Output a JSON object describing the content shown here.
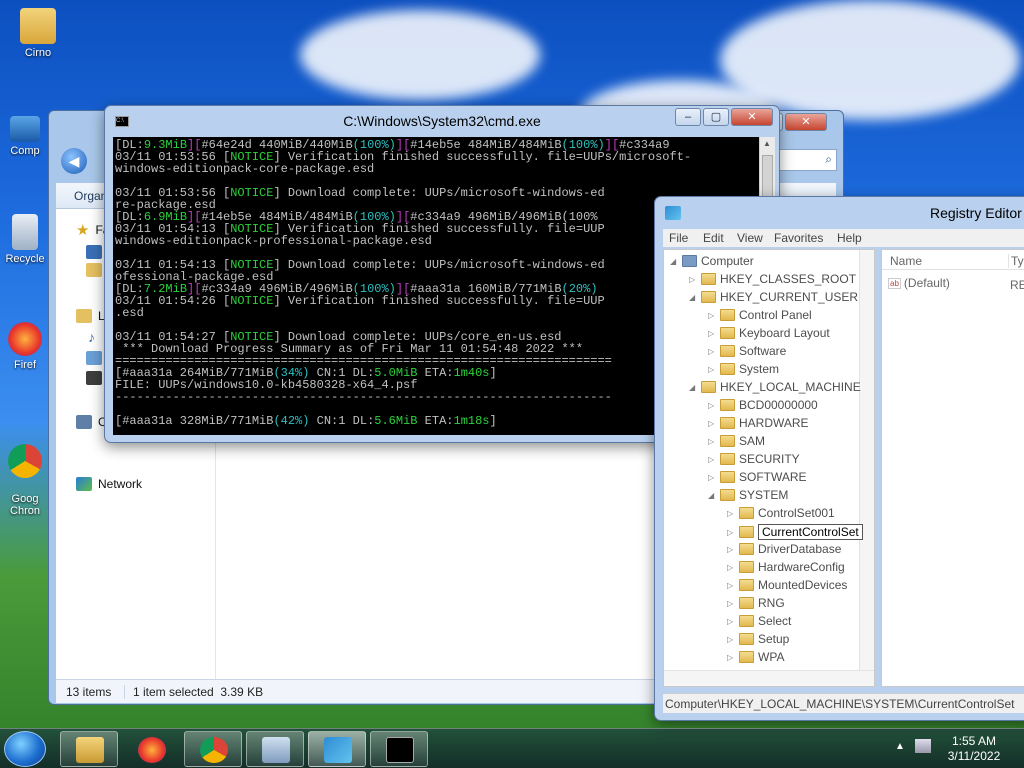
{
  "desktop": {
    "icons": [
      {
        "label": "Cirno"
      },
      {
        "label": "Comp"
      },
      {
        "label": "Recycle"
      },
      {
        "label": "Firef"
      },
      {
        "label": "Goog\nChron"
      }
    ]
  },
  "explorer": {
    "organize_label": "Organ",
    "nav_items": [
      "Fa",
      "Li",
      "Co",
      "Network"
    ],
    "status_items": "13 items",
    "status_selected": "1 item selected  3.39 KB"
  },
  "cmd": {
    "title": "C:\\Windows\\System32\\cmd.exe",
    "lines": [
      "[DL:9.3MiB][#64e24d 440MiB/440MiB(100%)][#14eb5e 484MiB/484MiB(100%)][#c334a9",
      "03/11 01:53:56 [NOTICE] Verification finished successfully. file=UUPs/microsoft-",
      "windows-editionpack-core-package.esd",
      "",
      "03/11 01:53:56 [NOTICE] Download complete: UUPs/microsoft-windows-ed",
      "re-package.esd",
      "[DL:6.9MiB][#14eb5e 484MiB/484MiB(100%)][#c334a9 496MiB/496MiB(100%",
      "03/11 01:54:13 [NOTICE] Verification finished successfully. file=UUP",
      "windows-editionpack-professional-package.esd",
      "",
      "03/11 01:54:13 [NOTICE] Download complete: UUPs/microsoft-windows-ed",
      "ofessional-package.esd",
      "[DL:7.2MiB][#c334a9 496MiB/496MiB(100%)][#aaa31a 160MiB/771MiB(20%)",
      "03/11 01:54:26 [NOTICE] Verification finished successfully. file=UUP",
      ".esd",
      "",
      "03/11 01:54:27 [NOTICE] Download complete: UUPs/core_en-us.esd",
      " *** Download Progress Summary as of Fri Mar 11 01:54:48 2022 ***",
      "=====================================================================",
      "[#aaa31a 264MiB/771MiB(34%) CN:1 DL:5.0MiB ETA:1m40s]",
      "FILE: UUPs/windows10.0-kb4580328-x64_4.psf",
      "---------------------------------------------------------------------",
      "",
      "[#aaa31a 328MiB/771MiB(42%) CN:1 DL:5.6MiB ETA:1m18s]"
    ]
  },
  "regedit": {
    "title": "Registry Editor",
    "menu": [
      "File",
      "Edit",
      "View",
      "Favorites",
      "Help"
    ],
    "columns": {
      "name": "Name",
      "type": "Ty"
    },
    "value_row": {
      "name": "(Default)",
      "type": "RE"
    },
    "tree": [
      {
        "label": "Computer",
        "indent": 0
      },
      {
        "label": "HKEY_CLASSES_ROOT",
        "indent": 1
      },
      {
        "label": "HKEY_CURRENT_USER",
        "indent": 1
      },
      {
        "label": "Control Panel",
        "indent": 2
      },
      {
        "label": "Keyboard Layout",
        "indent": 2
      },
      {
        "label": "Software",
        "indent": 2
      },
      {
        "label": "System",
        "indent": 2
      },
      {
        "label": "HKEY_LOCAL_MACHINE",
        "indent": 1
      },
      {
        "label": "BCD00000000",
        "indent": 2
      },
      {
        "label": "HARDWARE",
        "indent": 2
      },
      {
        "label": "SAM",
        "indent": 2
      },
      {
        "label": "SECURITY",
        "indent": 2
      },
      {
        "label": "SOFTWARE",
        "indent": 2
      },
      {
        "label": "SYSTEM",
        "indent": 2
      },
      {
        "label": "ControlSet001",
        "indent": 3
      },
      {
        "label": "CurrentControlSet",
        "indent": 3
      },
      {
        "label": "DriverDatabase",
        "indent": 3
      },
      {
        "label": "HardwareConfig",
        "indent": 3
      },
      {
        "label": "MountedDevices",
        "indent": 3
      },
      {
        "label": "RNG",
        "indent": 3
      },
      {
        "label": "Select",
        "indent": 3
      },
      {
        "label": "Setup",
        "indent": 3
      },
      {
        "label": "WPA",
        "indent": 3
      }
    ],
    "selected_key": "CurrentControlSet",
    "status_path": "Computer\\HKEY_LOCAL_MACHINE\\SYSTEM\\CurrentControlSet"
  },
  "taskbar": {
    "time": "1:55 AM",
    "date": "3/11/2022",
    "buttons": [
      "explorer",
      "firefox",
      "chrome",
      "resource-monitor",
      "registry-editor",
      "command-prompt"
    ]
  },
  "colors": {
    "notice": "#2bd13a",
    "dl_rate": "#2bd13a",
    "percent": "#2ec0c0",
    "bracket": "#c23ac2"
  }
}
